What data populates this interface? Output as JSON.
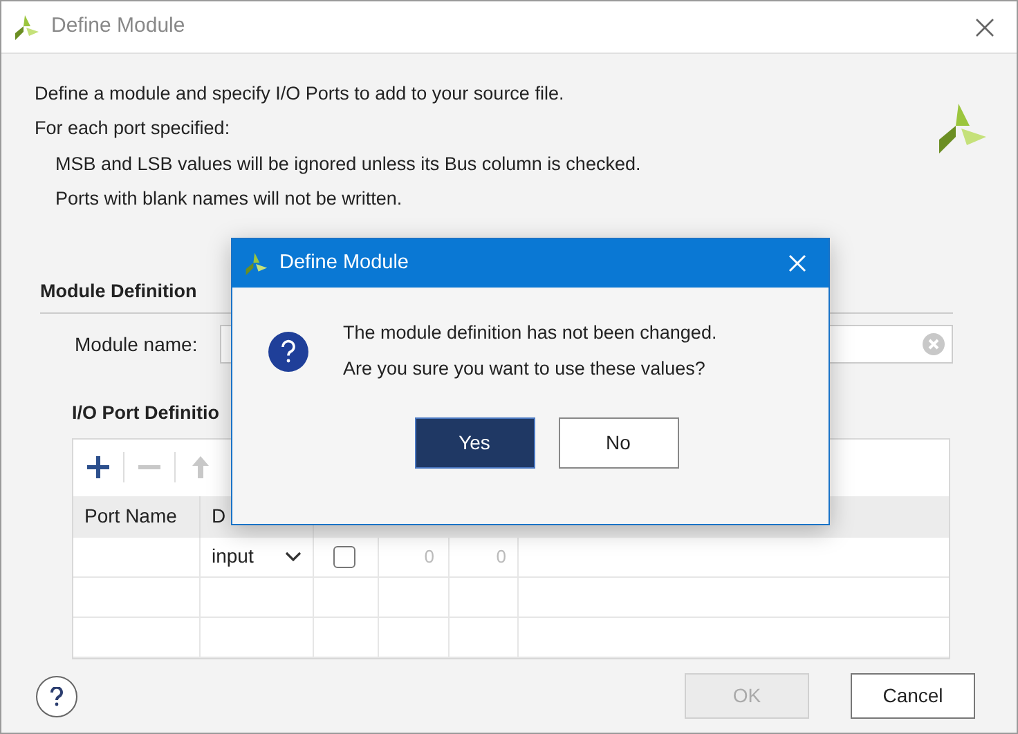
{
  "window": {
    "title": "Define Module"
  },
  "intro": {
    "lines": [
      "Define a module and specify I/O Ports to add to your source file.",
      "For each port specified:"
    ],
    "sub_lines": [
      "MSB and LSB values will be ignored unless its Bus column is checked.",
      "Ports with blank names will not be written."
    ]
  },
  "module_definition": {
    "heading": "Module Definition",
    "name_label": "Module name:"
  },
  "io_ports": {
    "heading": "I/O Port Definitio",
    "toolbar": [
      {
        "kind": "add",
        "disabled": false
      },
      {
        "kind": "remove",
        "disabled": true
      },
      {
        "kind": "up",
        "disabled": true
      }
    ],
    "columns": [
      "Port Name",
      "D"
    ],
    "rows": [
      {
        "direction": "input",
        "bus": false,
        "msb": "0",
        "lsb": "0"
      }
    ]
  },
  "buttons": [
    {
      "label": "OK",
      "disabled": true
    },
    {
      "label": "Cancel",
      "disabled": false
    }
  ],
  "modal": {
    "title": "Define Module",
    "message": [
      "The module definition has not been changed.",
      "Are you sure you want to use these values?"
    ],
    "buttons": [
      {
        "label": "Yes",
        "selected": true
      },
      {
        "label": "No",
        "selected": false
      }
    ]
  }
}
